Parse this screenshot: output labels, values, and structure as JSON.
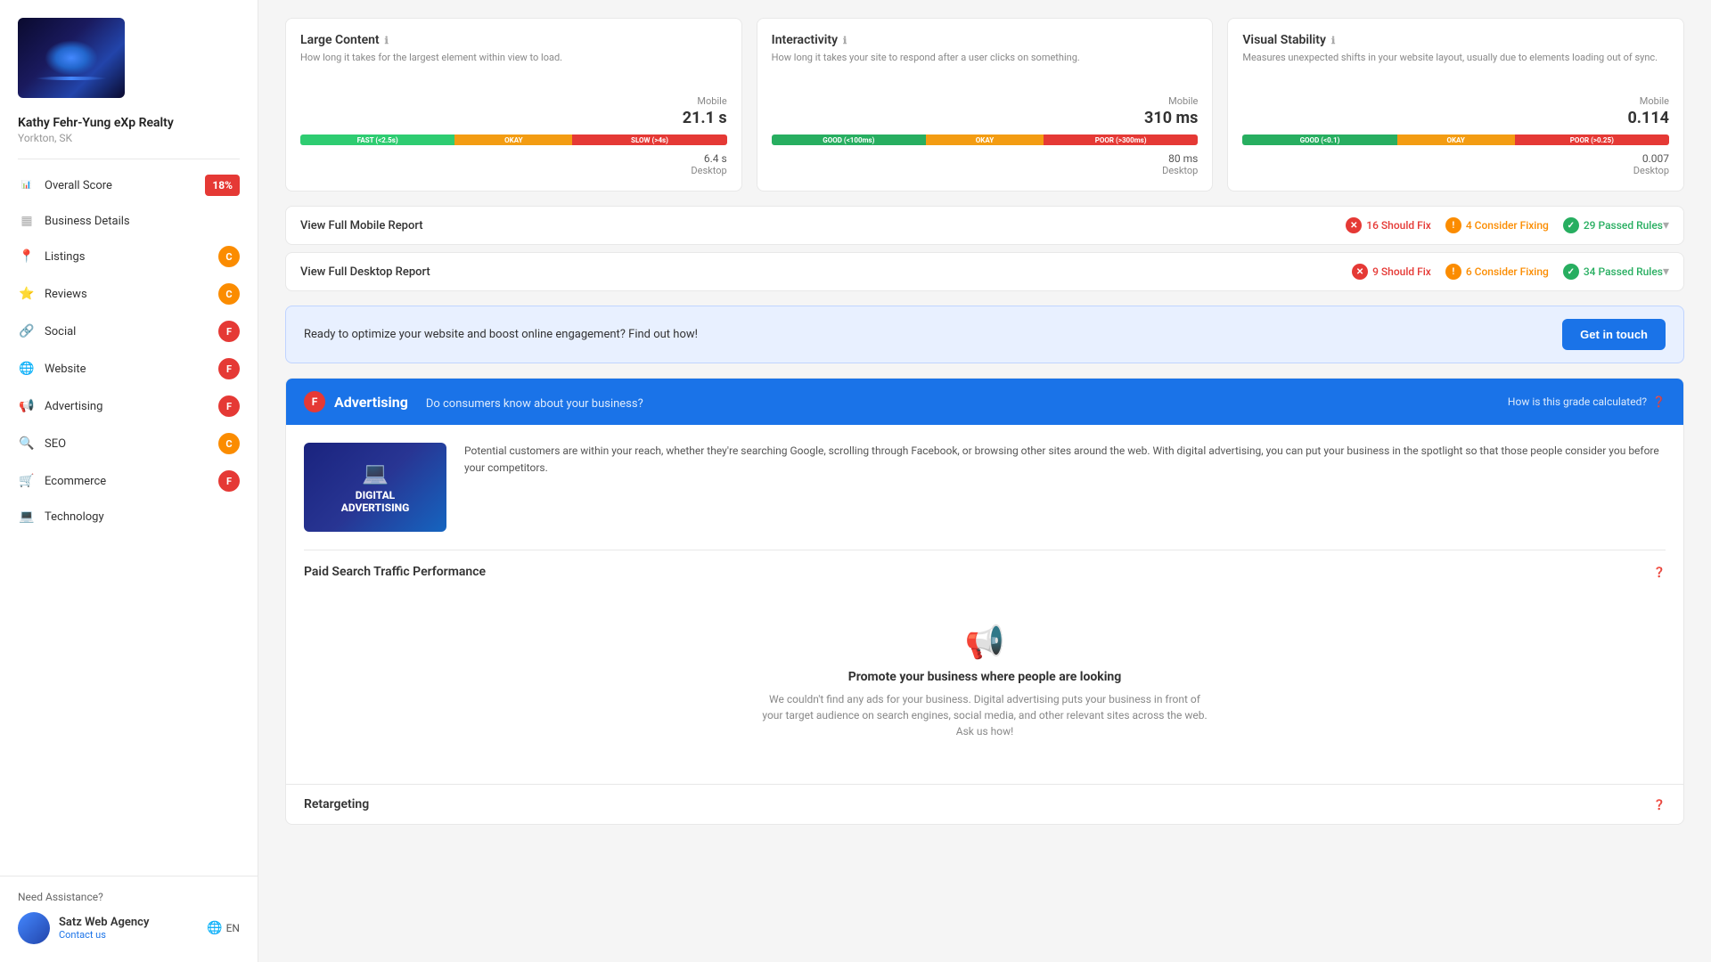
{
  "sidebar": {
    "business_name": "Kathy Fehr-Yung eXp Realty",
    "business_location": "Yorkton, SK",
    "nav_items": [
      {
        "id": "overall-score",
        "label": "Overall Score",
        "badge": "18%",
        "badge_type": "overall",
        "icon": "bar-chart"
      },
      {
        "id": "business-details",
        "label": "Business Details",
        "badge": null,
        "icon": "grid"
      },
      {
        "id": "listings",
        "label": "Listings",
        "badge": "C",
        "badge_type": "orange",
        "icon": "location"
      },
      {
        "id": "reviews",
        "label": "Reviews",
        "badge": "C",
        "badge_type": "orange",
        "icon": "star"
      },
      {
        "id": "social",
        "label": "Social",
        "badge": "F",
        "badge_type": "red",
        "icon": "share"
      },
      {
        "id": "website",
        "label": "Website",
        "badge": "F",
        "badge_type": "red",
        "icon": "globe"
      },
      {
        "id": "advertising",
        "label": "Advertising",
        "badge": "F",
        "badge_type": "red",
        "icon": "megaphone"
      },
      {
        "id": "seo",
        "label": "SEO",
        "badge": "C",
        "badge_type": "orange",
        "icon": "search"
      },
      {
        "id": "ecommerce",
        "label": "Ecommerce",
        "badge": "F",
        "badge_type": "red",
        "icon": "shopping"
      },
      {
        "id": "technology",
        "label": "Technology",
        "badge": null,
        "icon": "cpu"
      }
    ],
    "need_assistance": "Need Assistance?",
    "agency_name": "Satz Web Agency",
    "agency_contact": "Contact us",
    "language": "EN"
  },
  "metrics": {
    "large_content": {
      "title": "Large Content",
      "description": "How long it takes for the largest element within view to load.",
      "mobile_label": "Mobile",
      "mobile_value": "21.1 s",
      "segments": [
        {
          "label": "FAST (<2.5s)",
          "type": "green",
          "flex": 2
        },
        {
          "label": "OKAY",
          "type": "yellow",
          "flex": 1.5
        },
        {
          "label": "SLOW (>4s)",
          "type": "red",
          "flex": 2
        }
      ],
      "desktop_value": "6.4 s",
      "desktop_label": "Desktop"
    },
    "interactivity": {
      "title": "Interactivity",
      "description": "How long it takes your site to respond after a user clicks on something.",
      "mobile_label": "Mobile",
      "mobile_value": "310 ms",
      "segments": [
        {
          "label": "GOOD (<100ms)",
          "type": "good-green",
          "flex": 2
        },
        {
          "label": "OKAY",
          "type": "yellow",
          "flex": 1.5
        },
        {
          "label": "POOR (>300ms)",
          "type": "red",
          "flex": 2
        }
      ],
      "desktop_value": "80 ms",
      "desktop_label": "Desktop"
    },
    "visual_stability": {
      "title": "Visual Stability",
      "description": "Measures unexpected shifts in your website layout, usually due to elements loading out of sync.",
      "mobile_label": "Mobile",
      "mobile_value": "0.114",
      "segments": [
        {
          "label": "GOOD (<0.1)",
          "type": "good-green",
          "flex": 2
        },
        {
          "label": "OKAY",
          "type": "yellow",
          "flex": 1.5
        },
        {
          "label": "POOR (>0.25)",
          "type": "red",
          "flex": 2
        }
      ],
      "desktop_value": "0.007",
      "desktop_label": "Desktop"
    }
  },
  "reports": {
    "mobile": {
      "label": "View Full Mobile Report",
      "should_fix_count": "16 Should Fix",
      "consider_fixing_count": "4 Consider Fixing",
      "passed_count": "29 Passed Rules"
    },
    "desktop": {
      "label": "View Full Desktop Report",
      "should_fix_count": "9 Should Fix",
      "consider_fixing_count": "6 Consider Fixing",
      "passed_count": "34 Passed Rules"
    }
  },
  "cta": {
    "text": "Ready to optimize your website and boost online engagement? Find out how!",
    "button_label": "Get in touch"
  },
  "advertising": {
    "grade": "F",
    "title": "Advertising",
    "subtitle": "Do consumers know about your business?",
    "how_calculated": "How is this grade calculated?",
    "image_title": "DIGITAL\nADVERTISING",
    "description": "Potential customers are within your reach, whether they're searching Google, scrolling through Facebook, or browsing other sites around the web. With digital advertising, you can put your business in the spotlight so that those people consider you before your competitors.",
    "paid_search_title": "Paid Search Traffic Performance",
    "empty_title": "Promote your business where people are looking",
    "empty_desc": "We couldn't find any ads for your business. Digital advertising puts your business in front of your target audience on search engines, social media, and other relevant sites across the web. Ask us how!",
    "retargeting_label": "Retargeting"
  }
}
